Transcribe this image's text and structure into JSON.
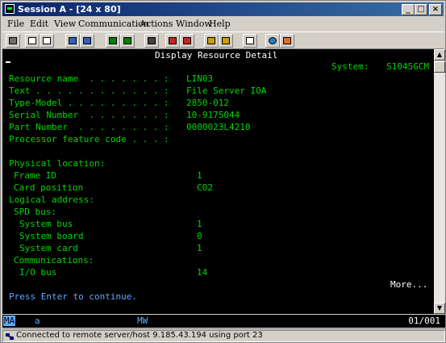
{
  "window": {
    "title": "Session A - [24 x 80]"
  },
  "menu": [
    "File",
    "Edit",
    "View",
    "Communication",
    "Actions",
    "Window",
    "Help"
  ],
  "toolbar_icons": [
    "print-icon",
    "copy-icon",
    "paste-icon",
    "send-icon",
    "receive-icon",
    "display-icon",
    "keypad-icon",
    "macro-record-icon",
    "macro-stop-icon",
    "macro-play-icon",
    "macro-edit-icon",
    "clipboard-icon",
    "globe-icon",
    "edit-icon"
  ],
  "terminal": {
    "header": "Display Resource Detail",
    "system_label": "System:",
    "system_value": "S1045GCM",
    "fields": [
      {
        "label": "Resource name  . . . . . . . :",
        "value": "LIN03"
      },
      {
        "label": "Text . . . . . . . . . . . . :",
        "value": "File Server IOA"
      },
      {
        "label": "Type-Model . . . . . . . . . :",
        "value": "2850-012"
      },
      {
        "label": "Serial Number  . . . . . . . :",
        "value": "10-9175044"
      },
      {
        "label": "Part Number  . . . . . . . . :",
        "value": "0000023L4210"
      },
      {
        "label": "Processor feature code . . . :",
        "value": ""
      }
    ],
    "location": [
      {
        "label": "Physical location:",
        "value": "",
        "indent": 0
      },
      {
        "label": "Frame ID",
        "value": "1",
        "indent": 1
      },
      {
        "label": "Card position",
        "value": "C02",
        "indent": 1
      },
      {
        "label": "Logical address:",
        "value": "",
        "indent": 0
      },
      {
        "label": "SPD bus:",
        "value": "",
        "indent": 1
      },
      {
        "label": "System bus",
        "value": "1",
        "indent": 2
      },
      {
        "label": "System board",
        "value": "0",
        "indent": 2
      },
      {
        "label": "System card",
        "value": "1",
        "indent": 2
      },
      {
        "label": "Communications:",
        "value": "",
        "indent": 1
      },
      {
        "label": "I/O bus",
        "value": "14",
        "indent": 2
      }
    ],
    "more": "More...",
    "prompt": "Press Enter to continue."
  },
  "oia": {
    "ma": "MA",
    "a": "a",
    "mw": "MW",
    "position": "01/001"
  },
  "status": {
    "text": "Connected to remote server/host 9.185.43.194 using port 23"
  },
  "colors": {
    "green": "#00d700",
    "white": "#ffffff",
    "blue": "#5fa8ff",
    "title_bar": "#0a246a"
  }
}
